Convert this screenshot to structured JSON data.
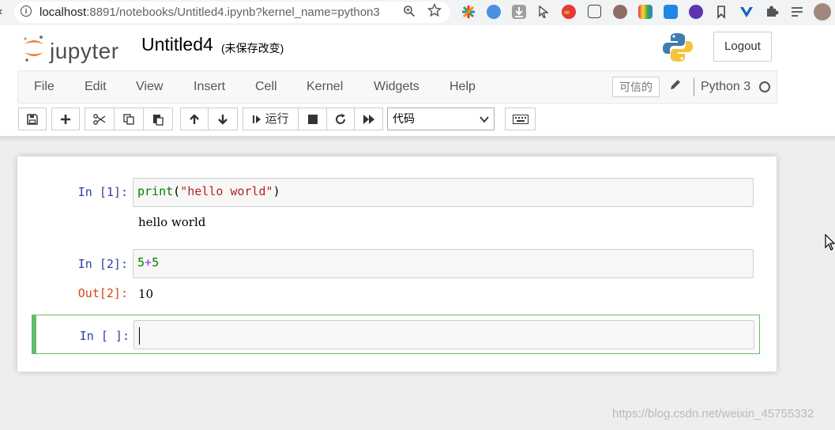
{
  "browser": {
    "url_host": "localhost",
    "url_rest": ":8891/notebooks/Untitled4.ipynb?kernel_name=python3",
    "info_glyph": "i",
    "back_glyph": "‹"
  },
  "header": {
    "logo_text": "jupyter",
    "notebook_title": "Untitled4",
    "save_status": "(未保存改变)",
    "logout_label": "Logout"
  },
  "menu": {
    "items": [
      "File",
      "Edit",
      "View",
      "Insert",
      "Cell",
      "Kernel",
      "Widgets",
      "Help"
    ],
    "trusted_label": "可信的",
    "kernel_name": "Python 3"
  },
  "toolbar": {
    "run_label": "运行",
    "cell_type": "代码",
    "icons": [
      "save-icon",
      "add-cell-icon",
      "cut-icon",
      "copy-icon",
      "paste-icon",
      "move-up-icon",
      "move-down-icon",
      "run-icon",
      "stop-icon",
      "restart-icon",
      "fast-forward-icon",
      "keyboard-icon"
    ]
  },
  "cells": [
    {
      "prompt": "In  [1]:",
      "code_builtin": "print",
      "code_open": "(",
      "code_string": "\"hello world\"",
      "code_close": ")",
      "output": "hello world"
    },
    {
      "prompt": "In  [2]:",
      "code_a": "5",
      "code_op": "+",
      "code_b": "5",
      "out_prompt": "Out[2]:",
      "output": "10"
    },
    {
      "prompt": "In  [ ]:"
    }
  ],
  "watermark": "https://blog.csdn.net/weixin_45755332",
  "colors": {
    "in_prompt": "#303f9f",
    "out_prompt": "#d84315",
    "edit_mode_border": "#66bb6a"
  }
}
